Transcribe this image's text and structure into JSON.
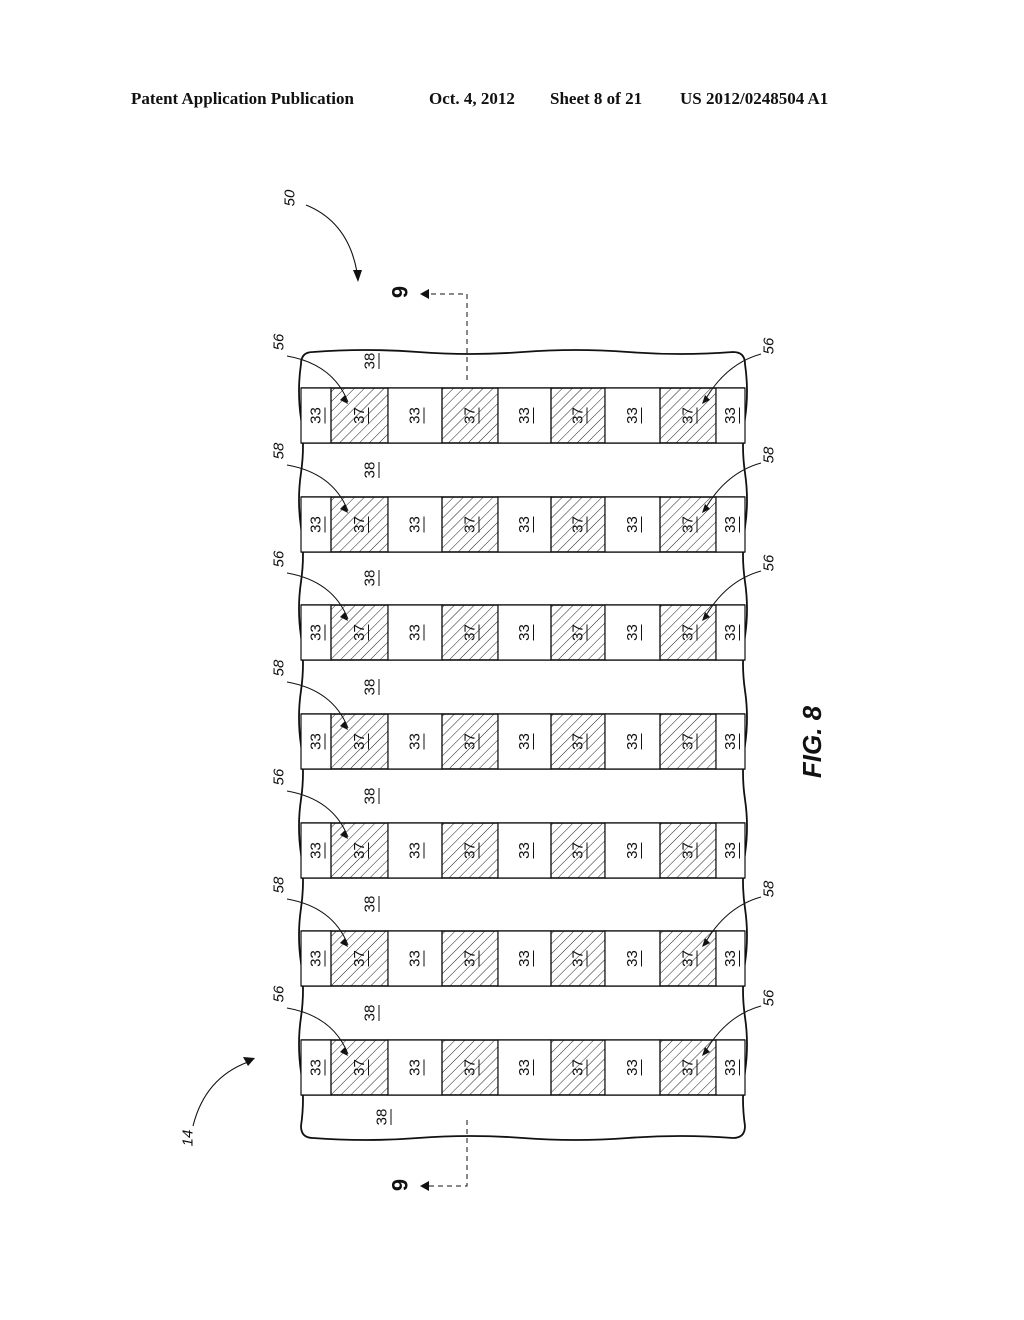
{
  "header": {
    "publication": "Patent Application Publication",
    "date": "Oct. 4, 2012",
    "sheet": "Sheet 8 of 21",
    "number": "US 2012/0248504 A1"
  },
  "figure": {
    "title": "FIG. 8",
    "assembly_ref": "50",
    "substrate_ref": "14",
    "section_label": "9",
    "region_ref": "38",
    "cell_types": {
      "plain": "33",
      "hatched": "37"
    },
    "column_pattern": [
      "33",
      "37",
      "33",
      "37",
      "33",
      "37",
      "33",
      "37",
      "33"
    ],
    "rows": [
      {
        "ref": "56",
        "left_label": true,
        "right_label": true
      },
      {
        "ref": "58",
        "left_label": true,
        "right_label": true
      },
      {
        "ref": "56",
        "left_label": true,
        "right_label": true
      },
      {
        "ref": "58",
        "left_label": true,
        "right_label": false
      },
      {
        "ref": "56",
        "left_label": true,
        "right_label": false
      },
      {
        "ref": "58",
        "left_label": true,
        "right_label": true
      },
      {
        "ref": "56",
        "left_label": true,
        "right_label": true
      }
    ]
  }
}
